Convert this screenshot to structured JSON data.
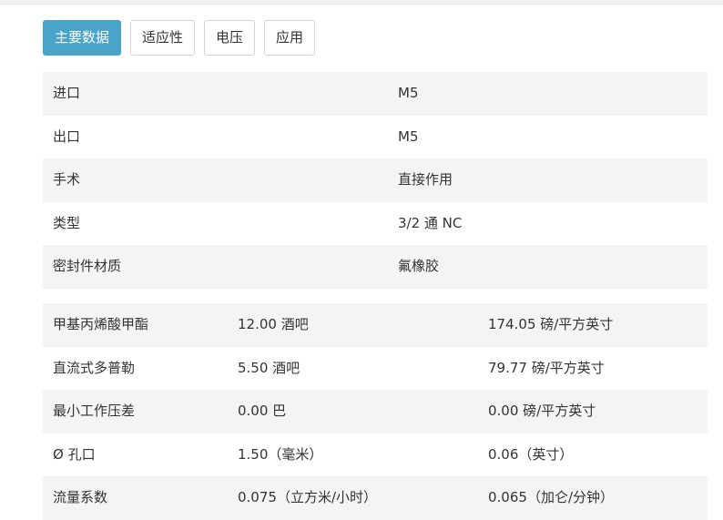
{
  "tabs": [
    {
      "label": "主要数据",
      "active": true
    },
    {
      "label": "适应性",
      "active": false
    },
    {
      "label": "电压",
      "active": false
    },
    {
      "label": "应用",
      "active": false
    }
  ],
  "specs": [
    {
      "label": "进口",
      "value": "M5"
    },
    {
      "label": "出口",
      "value": "M5"
    },
    {
      "label": "手术",
      "value": "直接作用"
    },
    {
      "label": "类型",
      "value": "3/2 通 NC"
    },
    {
      "label": "密封件材质",
      "value": "氟橡胶"
    }
  ],
  "metrics": [
    {
      "label": "甲基丙烯酸甲酯",
      "metric": "12.00 酒吧",
      "imperial": "174.05 磅/平方英寸"
    },
    {
      "label": "直流式多普勒",
      "metric": "5.50 酒吧",
      "imperial": "79.77 磅/平方英寸"
    },
    {
      "label": "最小工作压差",
      "metric": "0.00 巴",
      "imperial": "0.00 磅/平方英寸"
    },
    {
      "label": "Ø 孔口",
      "metric": "1.50（毫米）",
      "imperial": "0.06（英寸）"
    },
    {
      "label": "流量系数",
      "metric": "0.075（立方米/小时）",
      "imperial": "0.065（加仑/分钟）"
    }
  ],
  "colors": {
    "accent": "#4aa3c9",
    "stripe": "#f4f4f4"
  }
}
